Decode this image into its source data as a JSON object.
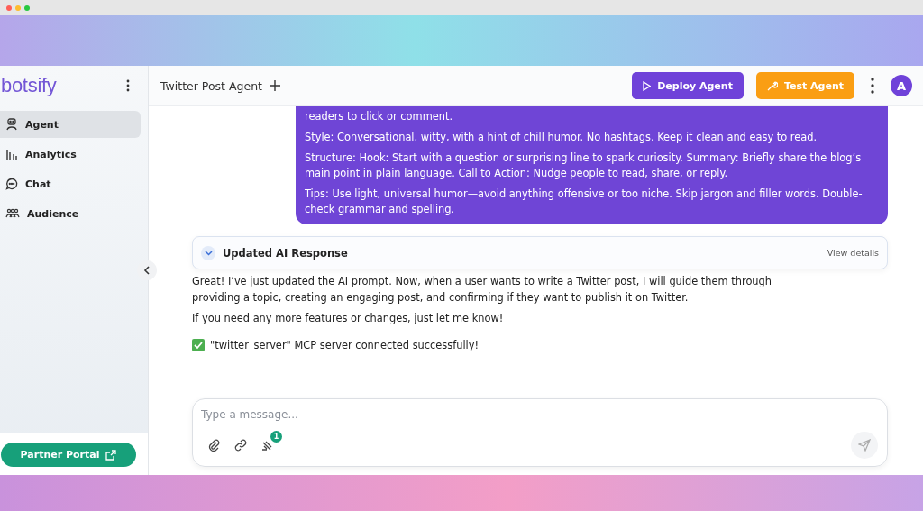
{
  "brand": "botsify",
  "sidebar": {
    "items": [
      {
        "label": "Agent",
        "selected": true
      },
      {
        "label": "Analytics",
        "selected": false
      },
      {
        "label": "Chat",
        "selected": false
      },
      {
        "label": "Audience",
        "selected": false
      }
    ],
    "partner_button": "Partner Portal"
  },
  "header": {
    "title": "Twitter Post Agent",
    "deploy_button": "Deploy Agent",
    "test_button": "Test Agent",
    "avatar": "A"
  },
  "user_message": {
    "paragraphs": [
      "readers to click or comment.",
      "Style: Conversational, witty, with a hint of chill humor. No hashtags. Keep it clean and easy to read.",
      "Structure: Hook: Start with a question or surprising line to spark curiosity. Summary: Briefly share the blog’s main point in plain language. Call to Action: Nudge people to read, share, or reply.",
      "Tips: Use light, universal humor—avoid anything offensive or too niche. Skip jargon and filler words. Double-check grammar and spelling."
    ]
  },
  "response_card": {
    "title": "Updated AI Response",
    "link": "View details",
    "expanded": false
  },
  "bot_message": {
    "paragraphs": [
      "Great! I’ve just updated the AI prompt. Now, when a user wants to write a Twitter post, I will guide them through providing a topic, creating an engaging post, and confirming if they want to publish it on Twitter.",
      "If you need any more features or changes, just let me know!"
    ],
    "status": "\"twitter_server\" MCP server connected successfully!"
  },
  "composer": {
    "placeholder": "Type a message...",
    "tools_badge": "1"
  }
}
